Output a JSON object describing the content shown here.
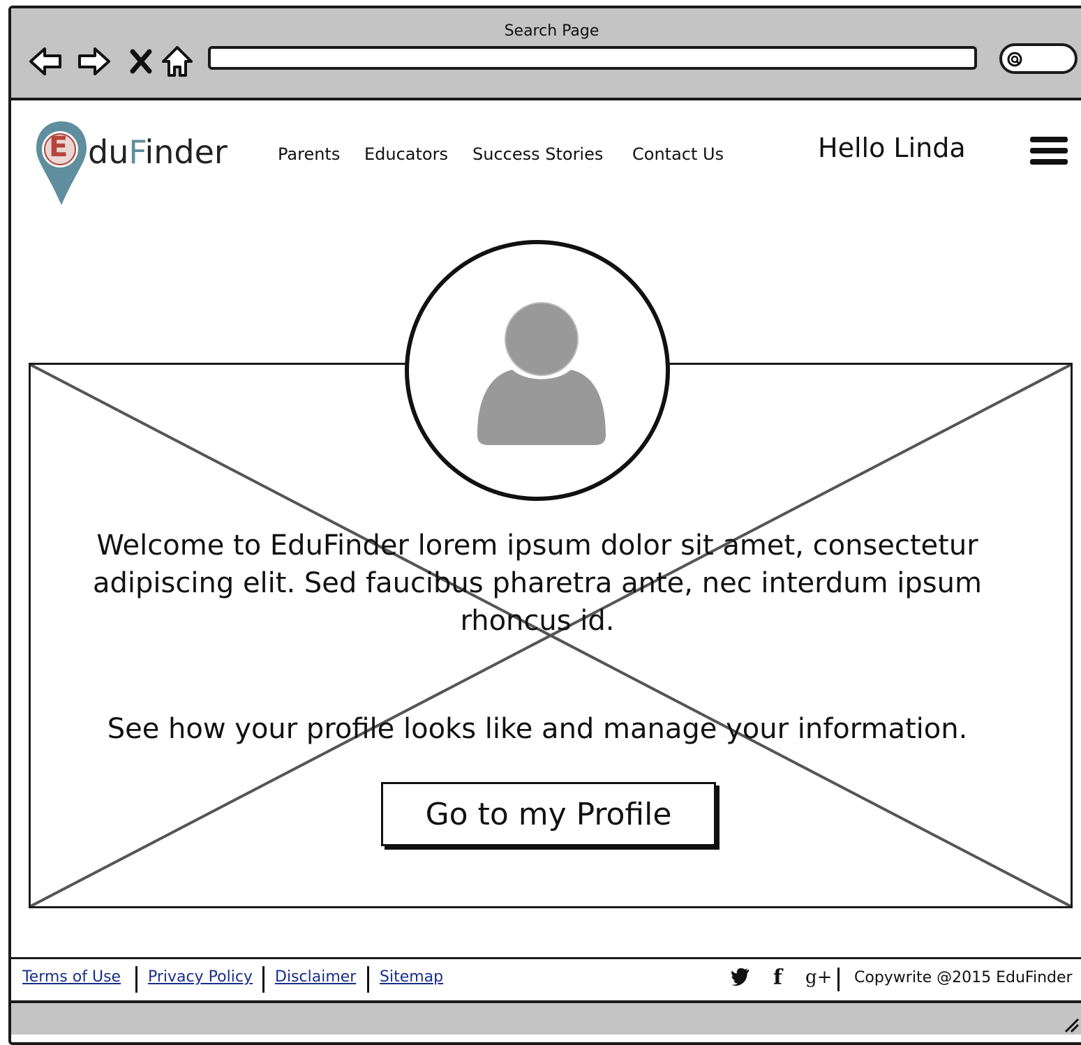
{
  "window": {
    "title": "Search Page"
  },
  "browser": {
    "nav_icons": [
      "back-arrow-icon",
      "forward-arrow-icon",
      "close-icon",
      "home-icon"
    ],
    "address_value": "",
    "search_icon": "search-icon"
  },
  "header": {
    "logo_text_1": "du",
    "logo_text_2": "F",
    "logo_text_3": "inder",
    "logo_letter": "E",
    "nav": [
      {
        "label": "Parents"
      },
      {
        "label": "Educators"
      },
      {
        "label": "Success Stories"
      },
      {
        "label": "Contact Us"
      }
    ],
    "greeting": "Hello Linda",
    "menu_icon": "hamburger-menu-icon"
  },
  "hero": {
    "welcome_text": "Welcome to EduFinder lorem ipsum dolor sit amet, consectetur adipiscing elit. Sed faucibus pharetra ante, nec interdum ipsum rhoncus id.",
    "subtext": "See how your profile looks like and manage your information.",
    "cta_label": "Go to my Profile",
    "avatar_icon": "user-avatar-icon"
  },
  "footer": {
    "links": [
      {
        "label": "Terms of Use"
      },
      {
        "label": "Privacy Policy"
      },
      {
        "label": "Disclaimer"
      },
      {
        "label": "Sitemap"
      }
    ],
    "social": [
      {
        "icon": "twitter-icon",
        "glyph": "🐦"
      },
      {
        "icon": "facebook-icon",
        "glyph": "f"
      },
      {
        "icon": "google-plus-icon",
        "glyph": "g+"
      }
    ],
    "copyright": "Copywrite @2015 EduFinder"
  },
  "colors": {
    "chrome": "#c4c4c4",
    "logo_accent": "#5f8e9e",
    "logo_red": "#b5453c",
    "link": "#1a2f8a",
    "avatar_gray": "#999999"
  }
}
